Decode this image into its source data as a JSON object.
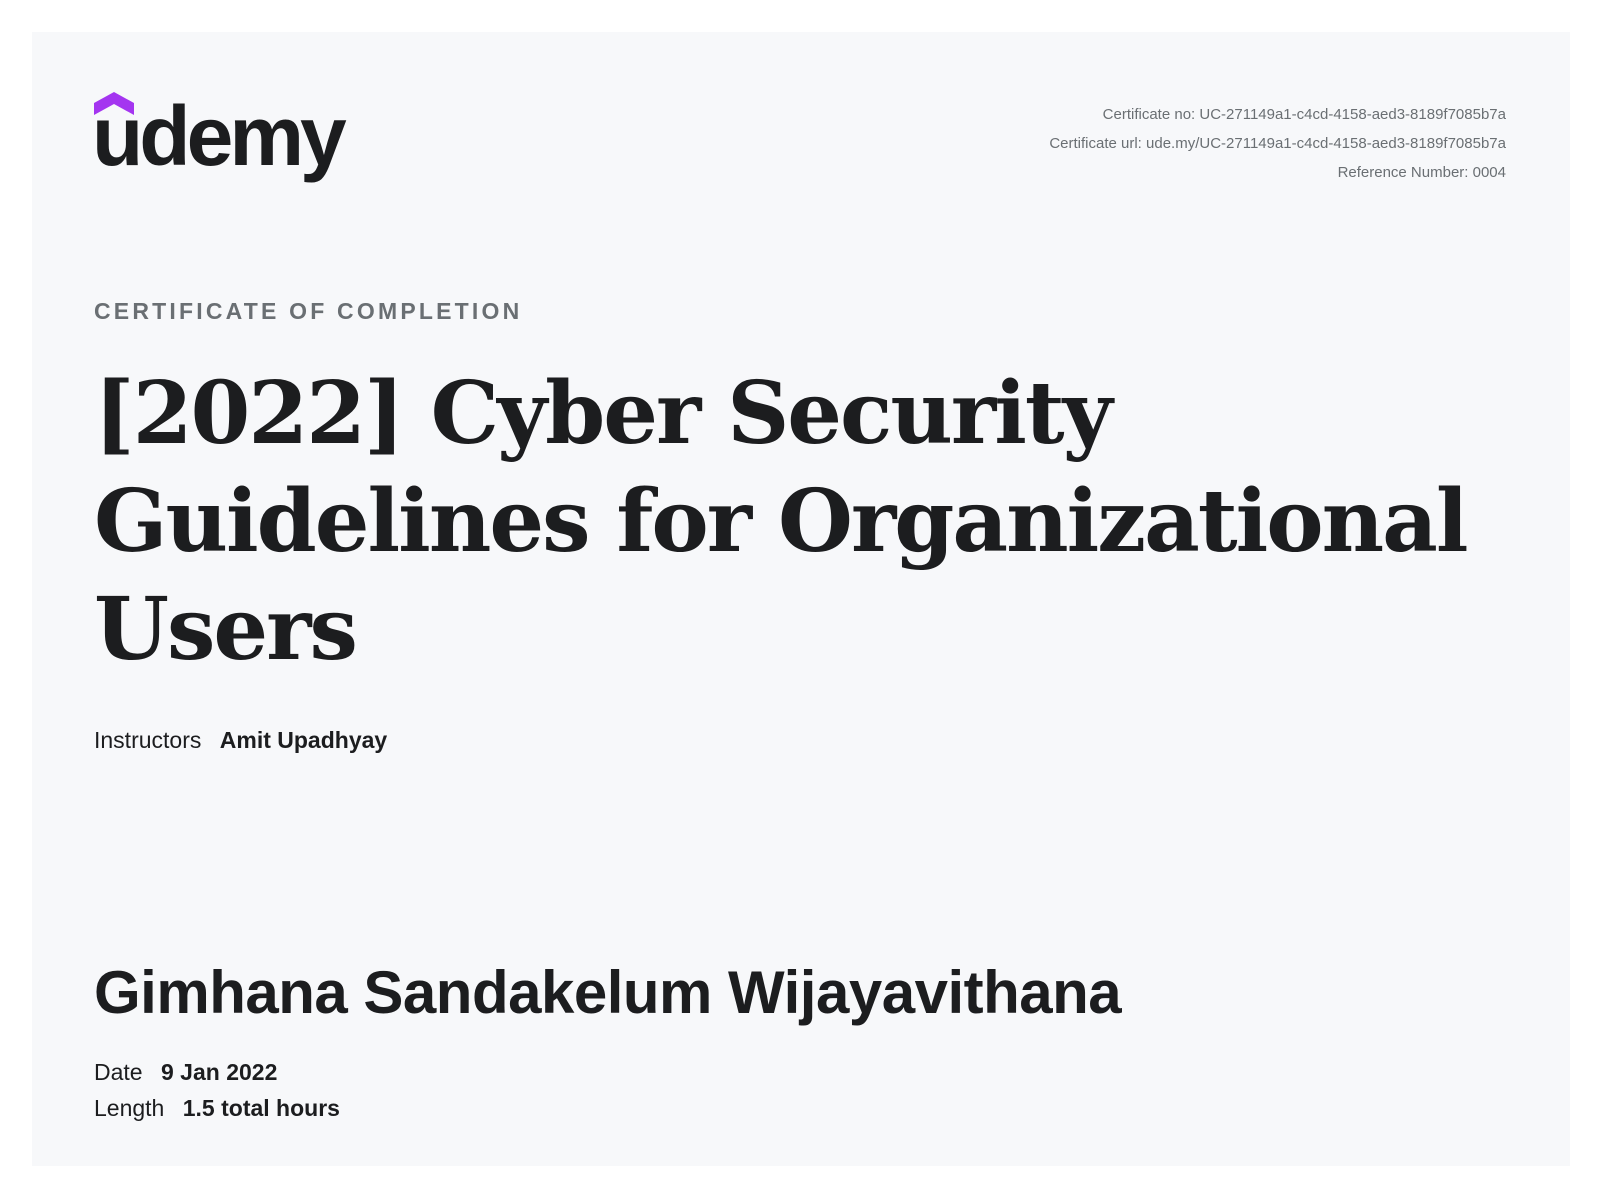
{
  "brand": {
    "name": "udemy",
    "logo_icon": "udemy-hat-icon",
    "accent_color": "#a435f0",
    "text_color": "#1c1d1f"
  },
  "certificate": {
    "number_line": "Certificate no: UC-271149a1-c4cd-4158-aed3-8189f7085b7a",
    "url_line": "Certificate url: ude.my/UC-271149a1-c4cd-4158-aed3-8189f7085b7a",
    "reference_line": "Reference Number: 0004",
    "heading": "CERTIFICATE OF COMPLETION",
    "course_title_lines": [
      "[2022] Cyber Security",
      "Guidelines for Organizational",
      "Users"
    ],
    "instructors_label": "Instructors",
    "instructors_value": "Amit Upadhyay",
    "recipient": "Gimhana Sandakelum Wijayavithana",
    "date_label": "Date",
    "date_value": "9 Jan 2022",
    "length_label": "Length",
    "length_value": "1.5 total hours"
  }
}
